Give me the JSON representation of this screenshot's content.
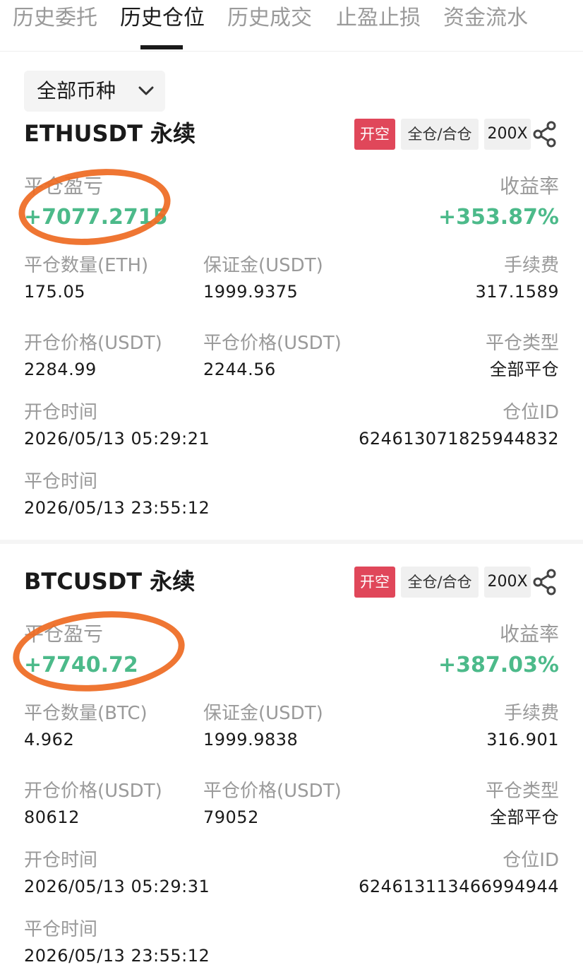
{
  "tabs": [
    {
      "label": "历史委托"
    },
    {
      "label": "历史仓位",
      "active": true
    },
    {
      "label": "历史成交"
    },
    {
      "label": "止盈止损"
    },
    {
      "label": "资金流水"
    }
  ],
  "filter": {
    "label": "全部币种",
    "icon": "chevron-down-icon"
  },
  "colors": {
    "profit_green": "#4cba8a",
    "short_red": "#e0475a",
    "annotation_orange": "#ee6a22"
  },
  "labels": {
    "pnl": "平仓盈亏",
    "roi": "收益率",
    "margin": "保证金(USDT)",
    "fee": "手续费",
    "open_price": "开仓价格(USDT)",
    "close_price": "平仓价格(USDT)",
    "close_type": "平仓类型",
    "open_time": "开仓时间",
    "position_id": "仓位ID",
    "close_time": "平仓时间"
  },
  "positions": [
    {
      "symbol": "ETHUSDT 永续",
      "side_tag": "开空",
      "mode_tag": "全仓/合仓",
      "leverage_tag": "200X",
      "pnl": "+7077.2715",
      "roi": "+353.87%",
      "qty_label": "平仓数量(ETH)",
      "qty": "175.05",
      "margin": "1999.9375",
      "fee": "317.1589",
      "open_price": "2284.99",
      "close_price": "2244.56",
      "close_type": "全部平仓",
      "open_time": "2026/05/13 05:29:21",
      "position_id": "624613071825944832",
      "close_time": "2026/05/13 23:55:12"
    },
    {
      "symbol": "BTCUSDT 永续",
      "side_tag": "开空",
      "mode_tag": "全仓/合仓",
      "leverage_tag": "200X",
      "pnl": "+7740.72",
      "roi": "+387.03%",
      "qty_label": "平仓数量(BTC)",
      "qty": "4.962",
      "margin": "1999.9838",
      "fee": "316.901",
      "open_price": "80612",
      "close_price": "79052",
      "close_type": "全部平仓",
      "open_time": "2026/05/13 05:29:31",
      "position_id": "624613113466994944",
      "close_time": "2026/05/13 23:55:12"
    }
  ]
}
